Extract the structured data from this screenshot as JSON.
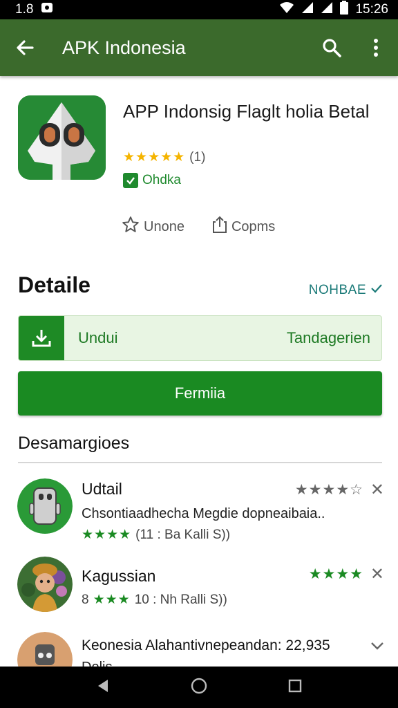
{
  "status_bar": {
    "left_text": "1.8",
    "time": "15:26"
  },
  "app_bar": {
    "title": "APK Indonesia"
  },
  "app": {
    "title": "APP Indonsig Flaglt holia Betal",
    "stars": "★★★★★",
    "rating_count": "(1)",
    "badge": "Ohdka"
  },
  "actions": {
    "wishlist": "Unone",
    "share": "Copms"
  },
  "details": {
    "title": "Detaile",
    "link": "NOHBAE",
    "download_label": "Undui",
    "download_right": "Tandagerien",
    "install_label": "Fermiia"
  },
  "list": {
    "title": "Desamargioes",
    "items": [
      {
        "name": "Udtail",
        "desc": "Chsontiaadhecha Megdie dopneaibaia..",
        "meta_stars": "★★★★",
        "meta_text": "(11 : Ba Kalli S))",
        "right_stars": "★★★★☆"
      },
      {
        "name": "Kagussian",
        "meta_prefix": "8",
        "meta_stars": "★★★",
        "meta_text": "10 : Nh Ralli S))",
        "right_stars": "★★★★"
      },
      {
        "name": "Keonesia Alahantivnepeandan: 22,935",
        "desc": "Delis"
      }
    ]
  },
  "colors": {
    "appbar": "#3b6a2c",
    "accent_green": "#1a8a22",
    "star_gold": "#f5b400",
    "link_teal": "#1b7a78"
  },
  "icons": [
    "back-arrow-icon",
    "search-icon",
    "more-vert-icon",
    "star-outline-icon",
    "share-icon",
    "download-icon",
    "check-icon",
    "close-icon",
    "chevron-down-icon"
  ]
}
